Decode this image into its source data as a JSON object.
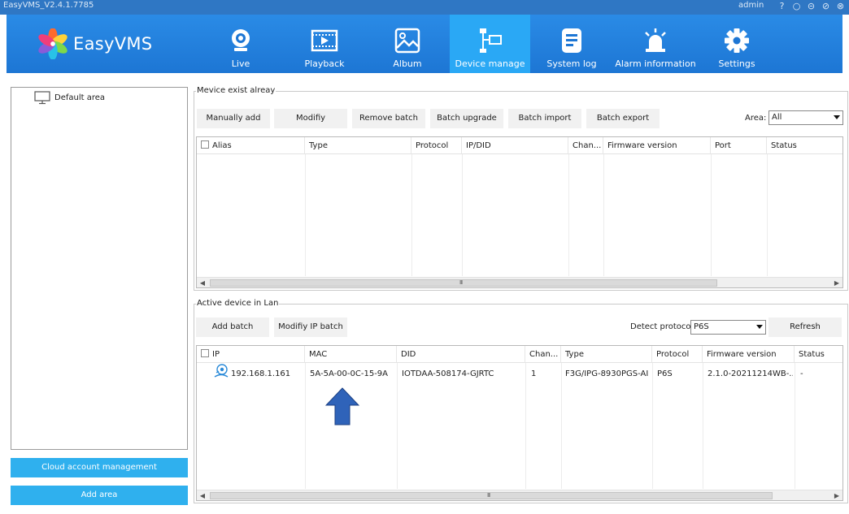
{
  "window": {
    "title": "EasyVMS_V2.4.1.7785",
    "user": "admin",
    "controls": [
      "?",
      "○",
      "⊝",
      "⊘",
      "⊗"
    ]
  },
  "header": {
    "logo_text": "EasyVMS",
    "nav": [
      {
        "label": "Live",
        "icon": "webcam-icon"
      },
      {
        "label": "Playback",
        "icon": "film-icon"
      },
      {
        "label": "Album",
        "icon": "image-icon"
      },
      {
        "label": "Device manage",
        "icon": "device-tree-icon",
        "active": true
      },
      {
        "label": "System log",
        "icon": "log-document-icon"
      },
      {
        "label": "Alarm information",
        "icon": "alarm-light-icon"
      },
      {
        "label": "Settings",
        "icon": "gear-icon"
      }
    ]
  },
  "left": {
    "tree_root": "Default area",
    "cloud_button": "Cloud account management",
    "add_area_button": "Add area"
  },
  "exist": {
    "title": "Mevice exist alreay",
    "buttons": [
      "Manually add",
      "Modifiy",
      "Remove batch",
      "Batch upgrade",
      "Batch import",
      "Batch export"
    ],
    "area_label": "Area:",
    "area_value": "All",
    "columns": [
      "Alias",
      "Type",
      "Protocol",
      "IP/DID",
      "Chan...",
      "Firmware version",
      "Port",
      "Status"
    ],
    "scroll_grip": "III"
  },
  "lan": {
    "title": "Active device in Lan",
    "add_batch": "Add batch",
    "modify_ip_batch": "Modifiy IP batch",
    "detect_label": "Detect protocol:",
    "detect_value": "P6S",
    "refresh": "Refresh",
    "columns": [
      "IP",
      "MAC",
      "DID",
      "Chan...",
      "Type",
      "Protocol",
      "Firmware version",
      "Status"
    ],
    "rows": [
      {
        "ip": "192.168.1.161",
        "mac": "5A-5A-00-0C-15-9A",
        "did": "IOTDAA-508174-GJRTC",
        "channel": "1",
        "type": "F3G/IPG-8930PGS-AI",
        "protocol": "P6S",
        "firmware": "2.1.0-20211214WB-...",
        "status": "-"
      }
    ],
    "scroll_grip": "III"
  },
  "colors": {
    "header": "#1d76d4",
    "active_tab": "#2aa8f5",
    "side_button": "#2fb0ee",
    "annotation_arrow": "#2f63b9"
  }
}
